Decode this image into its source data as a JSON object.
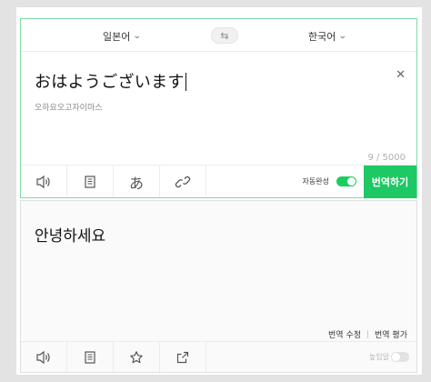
{
  "source": {
    "language": "일본어",
    "text": "おはようございます",
    "reading": "오하요오고자이마스",
    "counter": "9 / 5000",
    "clear_icon": "close-icon",
    "auto_complete_label": "자동완성",
    "auto_complete_on": true,
    "translate_button": "번역하기",
    "tools": [
      "speaker-icon",
      "dictionary-icon",
      "handwriting-icon",
      "link-icon"
    ]
  },
  "swap_icon": "swap-icon",
  "target": {
    "language": "한국어",
    "text": "안녕하세요",
    "edit_label": "번역 수정",
    "rate_label": "번역 평가",
    "honorific_label": "높임말",
    "honorific_on": false,
    "tools": [
      "speaker-icon",
      "dictionary-icon",
      "star-icon",
      "share-icon"
    ]
  },
  "colors": {
    "accent": "#1ec864",
    "panel_border": "#7fdca5",
    "background": "#e3e3e3"
  }
}
